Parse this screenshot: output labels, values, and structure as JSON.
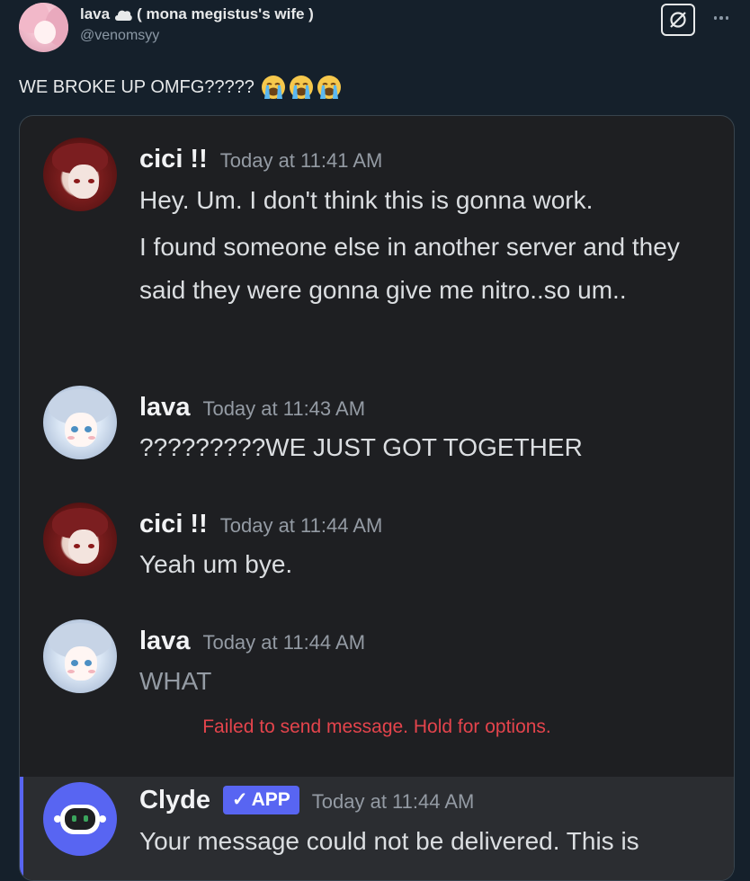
{
  "tweet": {
    "display_name": "lava",
    "name_icon": "cloud-icon",
    "name_suffix": "( mona megistus's wife )",
    "handle": "@venomsyy",
    "text": "WE BROKE UP OMFG?????",
    "emoji": "loudly-crying-face-emoji",
    "emoji_count": 3,
    "actions": {
      "grok": "grok-icon",
      "more": "more-icon"
    }
  },
  "discord": {
    "messages": [
      {
        "author": "cici !!",
        "time": "Today at 11:41 AM",
        "avatar": "cici-avatar",
        "lines": [
          "Hey. Um. I don't think this is gonna work.",
          "I found someone else in another server and they said they were gonna give me nitro..so um.."
        ]
      },
      {
        "author": "lava",
        "time": "Today at 11:43 AM",
        "avatar": "lava-avatar",
        "lines": [
          "?????????WE JUST GOT TOGETHER"
        ]
      },
      {
        "author": "cici !!",
        "time": "Today at 11:44 AM",
        "avatar": "cici-avatar",
        "lines": [
          "Yeah um bye."
        ]
      },
      {
        "author": "lava",
        "time": "Today at 11:44 AM",
        "avatar": "lava-avatar",
        "lines": [
          "WHAT"
        ]
      }
    ],
    "failed_notice": "Failed to send message. Hold for options.",
    "clyde": {
      "author": "Clyde",
      "badge": "APP",
      "badge_check": "✓",
      "time": "Today at 11:44 AM",
      "text": "Your message could not be delivered. This is"
    },
    "colors": {
      "background": "#1e1f22",
      "blurple": "#5865f2",
      "error": "#e4444c"
    }
  }
}
